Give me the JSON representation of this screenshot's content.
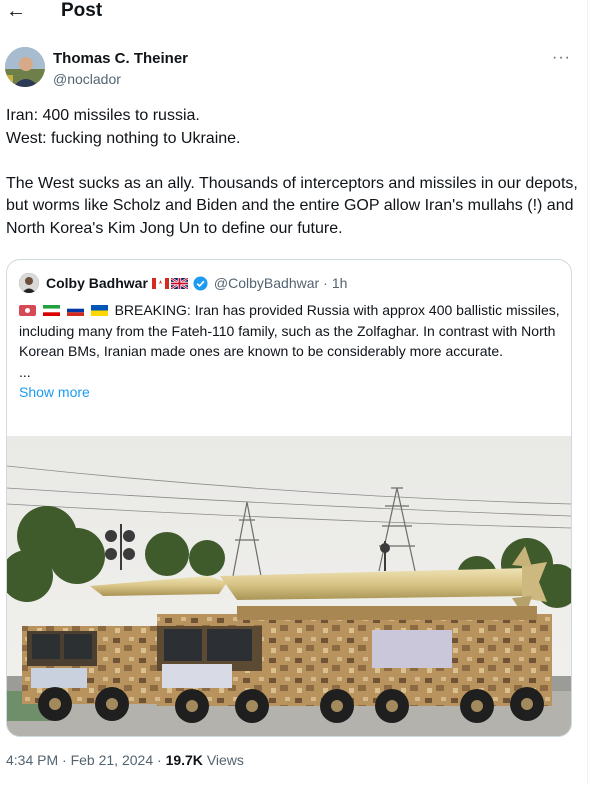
{
  "header": {
    "title": "Post"
  },
  "author": {
    "name": "Thomas C. Theiner",
    "handle": "@noclador"
  },
  "post": {
    "lines": [
      "Iran: 400 missiles to russia.",
      "West: fucking nothing to Ukraine.",
      "The West sucks as an ally. Thousands of interceptors and missiles in our depots, but worms like Scholz and Biden and the entire GOP allow Iran's mullahs (!) and North Korea's Kim Jong Un to define our future."
    ]
  },
  "quoted": {
    "name": "Colby Badhwar",
    "handle": "@ColbyBadhwar",
    "separator": "·",
    "time": "1h",
    "text": "BREAKING: Iran has provided Russia with approx 400 ballistic missiles, including many from the Fateh-110 family, such as the Zolfaghar. In contrast with North Korean BMs, Iranian made ones are known to be considerably more accurate.",
    "ellipsis": "...",
    "show_more": "Show more"
  },
  "footer": {
    "time": "4:34 PM",
    "separator": "·",
    "date": "Feb 21, 2024",
    "views_count": "19.7K",
    "views_label": "Views"
  },
  "icons": {
    "back": "arrow-left-icon",
    "more": "more-horizontal-icon",
    "verified": "verified-badge-icon"
  },
  "colors": {
    "link": "#1d9bf0",
    "secondary_text": "#536471",
    "border": "#cfd9de"
  }
}
